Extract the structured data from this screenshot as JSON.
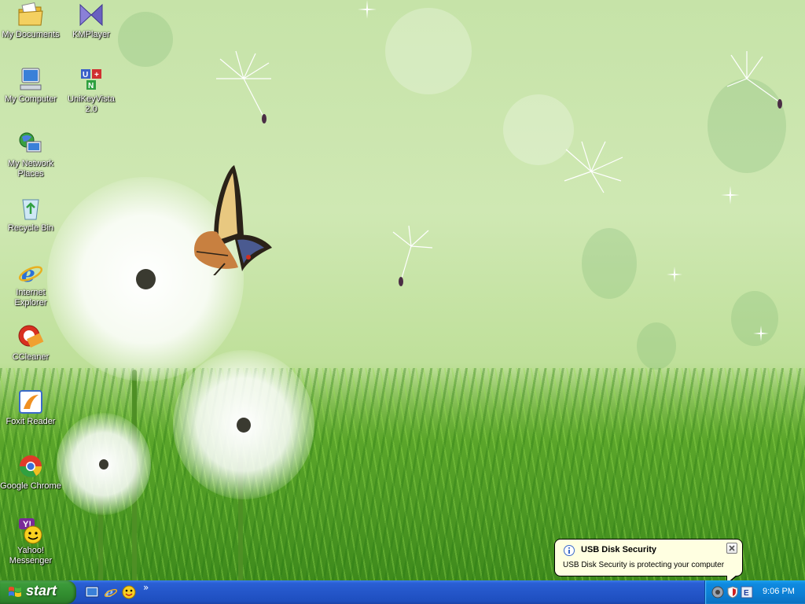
{
  "desktop": {
    "icons": [
      {
        "label": "My Documents",
        "icon": "folder-documents-icon"
      },
      {
        "label": "KMPlayer",
        "icon": "kmplayer-icon"
      },
      {
        "label": "My Computer",
        "icon": "computer-icon"
      },
      {
        "label": "UniKeyVista 2.0",
        "icon": "unikey-icon"
      },
      {
        "label": "My Network Places",
        "icon": "network-icon"
      },
      {
        "label": "Recycle Bin",
        "icon": "recycle-bin-icon"
      },
      {
        "label": "Internet Explorer",
        "icon": "internet-explorer-icon"
      },
      {
        "label": "CCleaner",
        "icon": "ccleaner-icon"
      },
      {
        "label": "Foxit Reader",
        "icon": "foxit-reader-icon"
      },
      {
        "label": "Google Chrome",
        "icon": "chrome-icon"
      },
      {
        "label": "Yahoo! Messenger",
        "icon": "yahoo-messenger-icon"
      }
    ]
  },
  "taskbar": {
    "start_label": "start",
    "quick_launch_more": "»",
    "clock": "9:06 PM",
    "colors": {
      "start": "#3c9a3a",
      "bar": "#2456c9",
      "tray": "#0c7fd4"
    }
  },
  "notification": {
    "title": "USB Disk Security",
    "message": "USB Disk Security is protecting your computer",
    "close": "×"
  }
}
